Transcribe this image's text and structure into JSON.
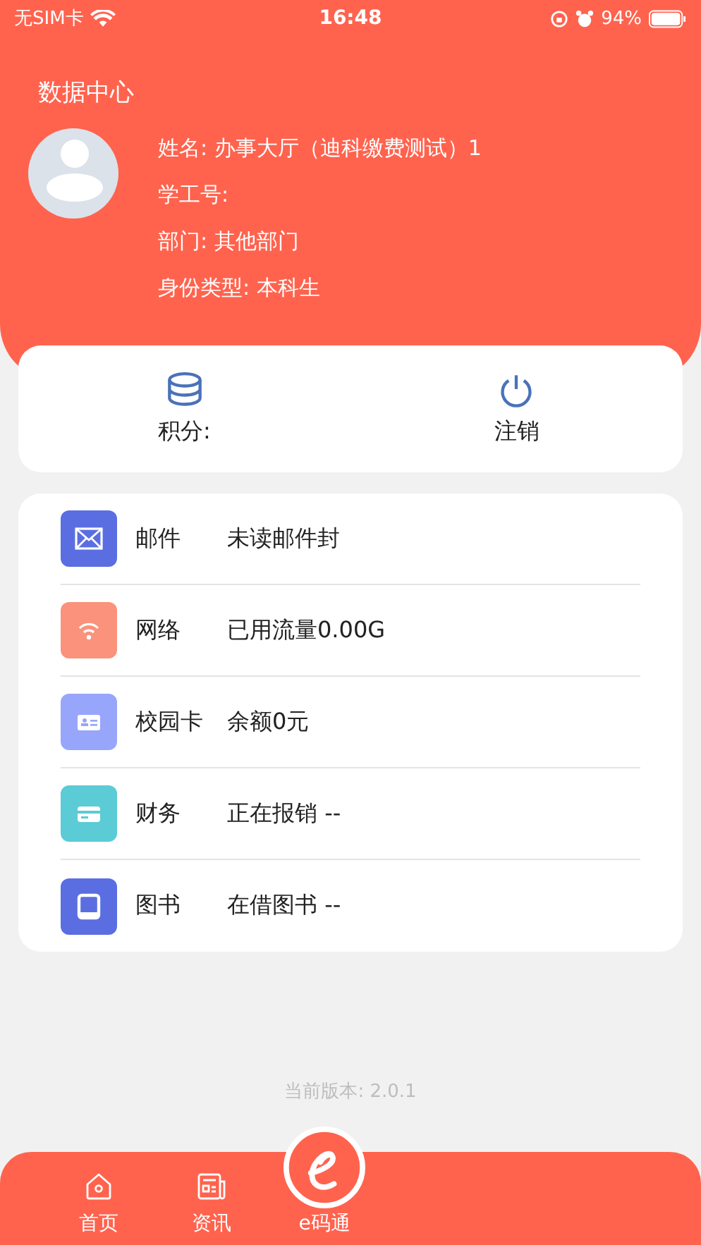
{
  "status_bar": {
    "carrier": "无SIM卡",
    "time": "16:48",
    "battery": "94%"
  },
  "header": {
    "title": "数据中心",
    "profile_lines": [
      "姓名: 办事大厅（迪科缴费测试）1",
      "学工号:",
      "部门: 其他部门",
      "身份类型: 本科生"
    ]
  },
  "actions": [
    {
      "kind": "points",
      "label": "积分:"
    },
    {
      "kind": "logout",
      "label": "注销"
    }
  ],
  "services": [
    {
      "kind": "mail",
      "color": "#5b6ee1",
      "name": "邮件",
      "value": "未读邮件封"
    },
    {
      "kind": "wifi",
      "color": "#fb927b",
      "name": "网络",
      "value": "已用流量0.00G"
    },
    {
      "kind": "card",
      "color": "#97a6fb",
      "name": "校园卡",
      "value": "余额0元"
    },
    {
      "kind": "finance",
      "color": "#5bcbd6",
      "name": "财务",
      "value": "正在报销 --"
    },
    {
      "kind": "book",
      "color": "#5b6ee1",
      "name": "图书",
      "value": "在借图书 --"
    }
  ],
  "version": "当前版本: 2.0.1",
  "tab_bar": [
    {
      "kind": "home",
      "label": "首页",
      "selected": false
    },
    {
      "kind": "news",
      "label": "资讯",
      "selected": false
    },
    {
      "kind": "ecode",
      "label": "e码通",
      "selected": false
    }
  ]
}
